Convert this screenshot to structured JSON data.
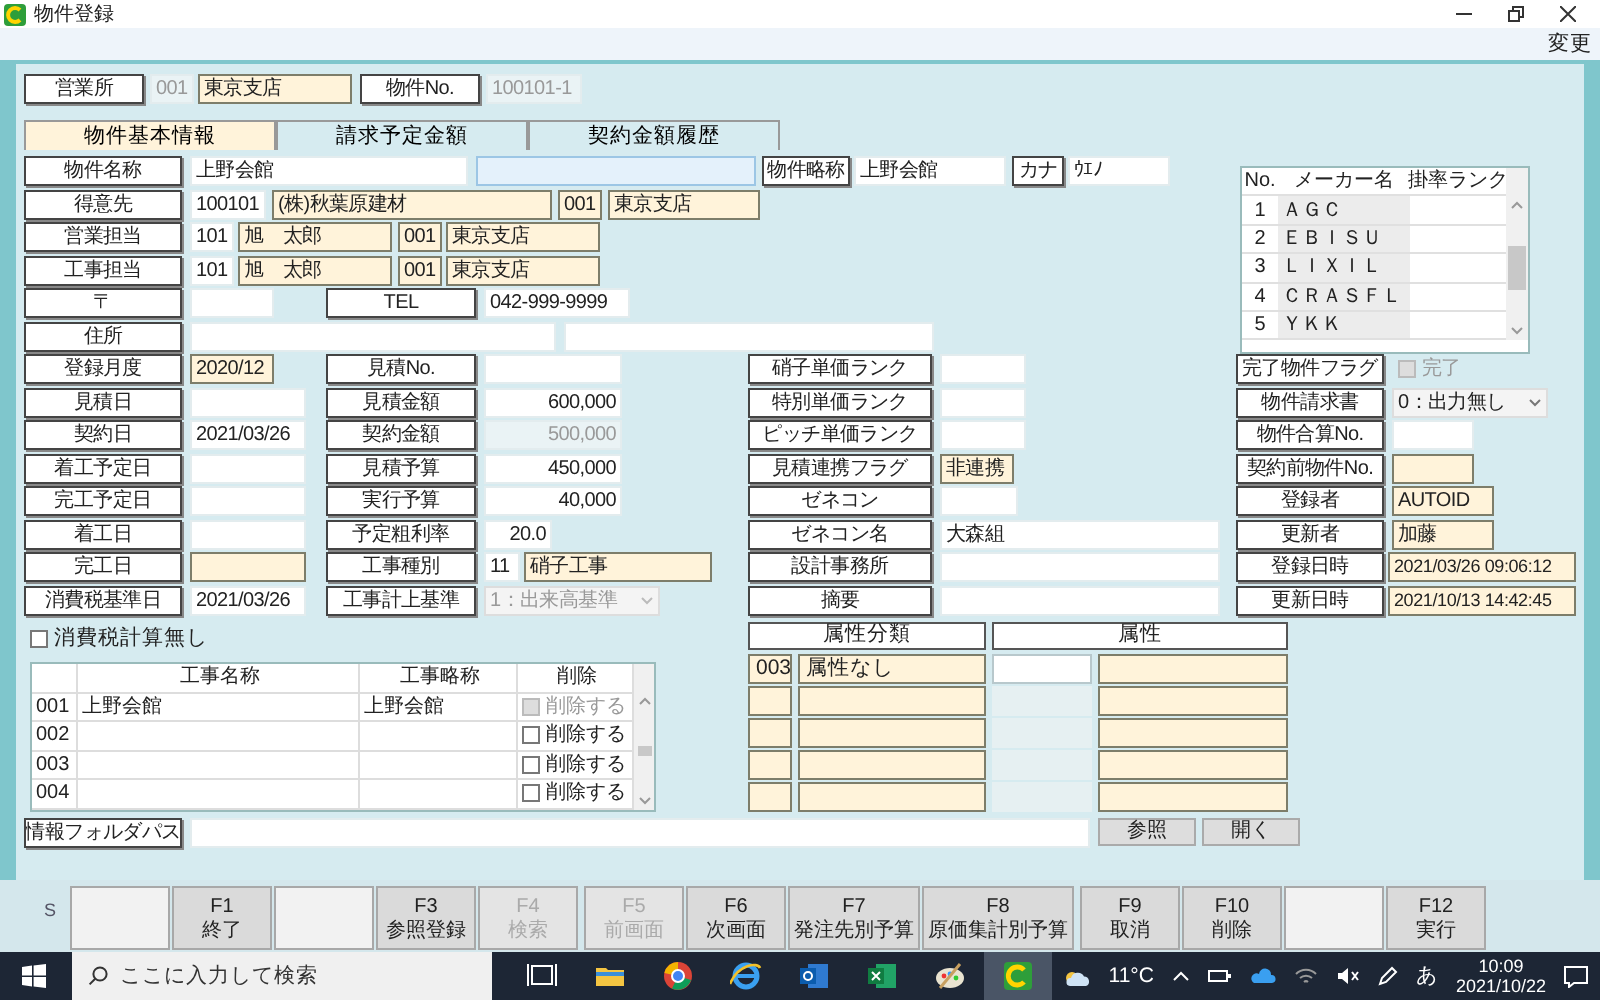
{
  "window": {
    "title": "物件登録",
    "menu": [
      "変更"
    ]
  },
  "header": {
    "office_label": "営業所",
    "office_code": "001",
    "office_name": "東京支店",
    "property_no_label": "物件No.",
    "property_no": "100101-1"
  },
  "tabs": [
    {
      "label": "物件基本情報",
      "selected": true
    },
    {
      "label": "請求予定金額",
      "selected": false
    },
    {
      "label": "契約金額履歴",
      "selected": false
    }
  ],
  "form_rows": [
    [
      {
        "kind": "label",
        "text": "物件名称"
      },
      {
        "kind": "input",
        "text": "上野会館"
      },
      {
        "kind": "input",
        "focused": true
      },
      {
        "kind": "label",
        "text": "物件略称"
      },
      {
        "kind": "input",
        "text": "上野会館"
      },
      {
        "kind": "label",
        "text": "カナ"
      },
      {
        "kind": "input",
        "text": "ｳｴﾉ"
      }
    ],
    [
      {
        "kind": "label",
        "text": "得意先"
      },
      {
        "kind": "input",
        "text": "100101"
      },
      {
        "kind": "lookup",
        "text": "(株)秋葉原建材"
      },
      {
        "kind": "lookup",
        "text": "001"
      },
      {
        "kind": "lookup",
        "text": "東京支店"
      }
    ],
    [
      {
        "kind": "label",
        "text": "営業担当"
      },
      {
        "kind": "input",
        "text": "101"
      },
      {
        "kind": "lookup",
        "text": "旭　太郎"
      },
      {
        "kind": "lookup",
        "text": "001"
      },
      {
        "kind": "lookup",
        "text": "東京支店"
      }
    ],
    [
      {
        "kind": "label",
        "text": "工事担当"
      },
      {
        "kind": "input",
        "text": "101"
      },
      {
        "kind": "lookup",
        "text": "旭　太郎"
      },
      {
        "kind": "lookup",
        "text": "001"
      },
      {
        "kind": "lookup",
        "text": "東京支店"
      }
    ],
    [
      {
        "kind": "label",
        "text": "〒"
      },
      {
        "kind": "input"
      },
      {
        "kind": "label",
        "text": "TEL"
      },
      {
        "kind": "input",
        "text": "042-999-9999"
      }
    ],
    [
      {
        "kind": "label",
        "text": "住所"
      },
      {
        "kind": "input"
      },
      {
        "kind": "input"
      }
    ],
    [
      {
        "kind": "label",
        "text": "登録月度"
      },
      {
        "kind": "lookup",
        "text": "2020/12"
      },
      {
        "kind": "label",
        "text": "見積No."
      },
      {
        "kind": "input"
      },
      {
        "kind": "label",
        "text": "硝子単価ランク"
      },
      {
        "kind": "input"
      },
      {
        "kind": "label",
        "text": "完了物件フラグ"
      },
      {
        "kind": "checkbox",
        "text": "完了",
        "checked": false,
        "disabled": true
      }
    ],
    [
      {
        "kind": "label",
        "text": "見積日"
      },
      {
        "kind": "input"
      },
      {
        "kind": "label",
        "text": "見積金額"
      },
      {
        "kind": "number",
        "text": "600,000"
      },
      {
        "kind": "label",
        "text": "特別単価ランク"
      },
      {
        "kind": "input"
      },
      {
        "kind": "label",
        "text": "物件請求書"
      },
      {
        "kind": "select",
        "text": "0：出力無し"
      }
    ],
    [
      {
        "kind": "label",
        "text": "契約日"
      },
      {
        "kind": "input",
        "text": "2021/03/26"
      },
      {
        "kind": "label",
        "text": "契約金額"
      },
      {
        "kind": "number",
        "text": "500,000",
        "disabled": true
      },
      {
        "kind": "label",
        "text": "ピッチ単価ランク"
      },
      {
        "kind": "input"
      },
      {
        "kind": "label",
        "text": "物件合算No."
      },
      {
        "kind": "input"
      }
    ],
    [
      {
        "kind": "label",
        "text": "着工予定日"
      },
      {
        "kind": "input"
      },
      {
        "kind": "label",
        "text": "見積予算"
      },
      {
        "kind": "number",
        "text": "450,000"
      },
      {
        "kind": "label",
        "text": "見積連携フラグ"
      },
      {
        "kind": "lookup",
        "text": "非連携"
      },
      {
        "kind": "label",
        "text": "契約前物件No."
      },
      {
        "kind": "lookup"
      }
    ],
    [
      {
        "kind": "label",
        "text": "完工予定日"
      },
      {
        "kind": "input"
      },
      {
        "kind": "label",
        "text": "実行予算"
      },
      {
        "kind": "number",
        "text": "40,000"
      },
      {
        "kind": "label",
        "text": "ゼネコン"
      },
      {
        "kind": "input"
      },
      {
        "kind": "label",
        "text": "登録者"
      },
      {
        "kind": "lookup",
        "text": "AUTOID"
      }
    ],
    [
      {
        "kind": "label",
        "text": "着工日"
      },
      {
        "kind": "input"
      },
      {
        "kind": "label",
        "text": "予定粗利率"
      },
      {
        "kind": "number",
        "text": "20.0"
      },
      {
        "kind": "label",
        "text": "ゼネコン名"
      },
      {
        "kind": "input",
        "text": "大森組"
      },
      {
        "kind": "label",
        "text": "更新者"
      },
      {
        "kind": "lookup",
        "text": "加藤"
      }
    ],
    [
      {
        "kind": "label",
        "text": "完工日"
      },
      {
        "kind": "lookup"
      },
      {
        "kind": "label",
        "text": "工事種別"
      },
      {
        "kind": "input",
        "text": "11"
      },
      {
        "kind": "lookup",
        "text": "硝子工事"
      },
      {
        "kind": "label",
        "text": "設計事務所"
      },
      {
        "kind": "input"
      },
      {
        "kind": "label",
        "text": "登録日時"
      },
      {
        "kind": "lookup",
        "text": "2021/03/26 09:06:12"
      }
    ],
    [
      {
        "kind": "label",
        "text": "消費税基準日"
      },
      {
        "kind": "input",
        "text": "2021/03/26"
      },
      {
        "kind": "label",
        "text": "工事計上基準"
      },
      {
        "kind": "select",
        "text": "1：出来高基準",
        "disabled": true
      },
      {
        "kind": "label",
        "text": "摘要"
      },
      {
        "kind": "input"
      },
      {
        "kind": "label",
        "text": "更新日時"
      },
      {
        "kind": "lookup",
        "text": "2021/10/13 14:42:45"
      }
    ]
  ],
  "maker_table": {
    "columns": [
      "No.",
      "メーカー名",
      "掛率ランク"
    ],
    "rows": [
      {
        "no": "1",
        "maker": "ＡＧＣ"
      },
      {
        "no": "2",
        "maker": "ＥＢＩＳＵ"
      },
      {
        "no": "3",
        "maker": "ＬＩＸＩＬ"
      },
      {
        "no": "4",
        "maker": "ＣＲＡＳＦＬ"
      },
      {
        "no": "5",
        "maker": "ＹＫＫ"
      }
    ]
  },
  "tax_checkbox": {
    "text": "消費税計算無し",
    "checked": false
  },
  "work_table": {
    "columns": [
      "工事名称",
      "工事略称",
      "削除"
    ],
    "rows": [
      {
        "no": "001",
        "name": "上野会館",
        "short": "上野会館",
        "delete": {
          "text": "削除する",
          "checked": false,
          "disabled": true
        }
      },
      {
        "no": "002",
        "delete": {
          "text": "削除する",
          "checked": false,
          "disabled": false
        }
      },
      {
        "no": "003",
        "delete": {
          "text": "削除する",
          "checked": false,
          "disabled": false
        }
      },
      {
        "no": "004",
        "delete": {
          "text": "削除する",
          "checked": false,
          "disabled": false
        }
      }
    ]
  },
  "attributes": {
    "columns": [
      "属性分類",
      "属性"
    ],
    "rows": [
      {
        "code": "003",
        "category": "属性なし",
        "disabled": false
      },
      {
        "disabled": true
      },
      {
        "disabled": true
      },
      {
        "disabled": true
      },
      {
        "disabled": true
      }
    ]
  },
  "folder": {
    "label": "情報フォルダパス",
    "buttons": [
      "参照",
      "開く"
    ]
  },
  "function_bar": {
    "mode": "S",
    "keys": [
      {
        "kind": "blank"
      },
      {
        "kind": "key",
        "key": "F1",
        "label": "終了",
        "disabled": false
      },
      {
        "kind": "blank"
      },
      {
        "kind": "key",
        "key": "F3",
        "label": "参照登録",
        "disabled": false
      },
      {
        "kind": "key",
        "key": "F4",
        "label": "検索",
        "disabled": true
      },
      {
        "kind": "key",
        "key": "F5",
        "label": "前画面",
        "disabled": true
      },
      {
        "kind": "key",
        "key": "F6",
        "label": "次画面",
        "disabled": false
      },
      {
        "kind": "key",
        "key": "F7",
        "label": "発注先別予算",
        "disabled": false
      },
      {
        "kind": "key",
        "key": "F8",
        "label": "原価集計別予算",
        "disabled": false
      },
      {
        "kind": "key",
        "key": "F9",
        "label": "取消",
        "disabled": false
      },
      {
        "kind": "key",
        "key": "F10",
        "label": "削除",
        "disabled": false
      },
      {
        "kind": "blank"
      },
      {
        "kind": "key",
        "key": "F12",
        "label": "実行",
        "disabled": false
      }
    ]
  },
  "taskbar": {
    "search_placeholder": "ここに入力して検索",
    "weather": "11°C",
    "ime": "あ",
    "time": "10:09",
    "date": "2021/10/22"
  }
}
